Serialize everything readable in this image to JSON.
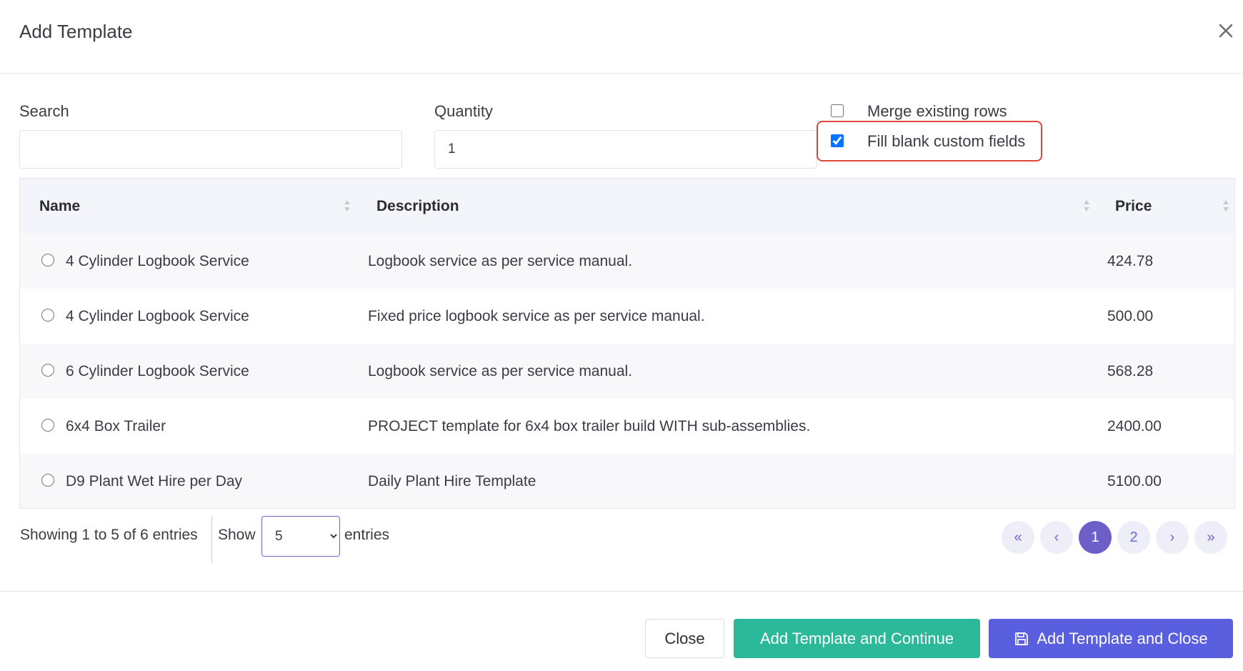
{
  "modal": {
    "title": "Add Template",
    "close_icon": "close-icon"
  },
  "form": {
    "search_label": "Search",
    "search_value": "",
    "quantity_label": "Quantity",
    "quantity_value": "1",
    "merge_label": "Merge existing rows",
    "merge_checked": false,
    "fill_label": "Fill blank custom fields",
    "fill_checked": true,
    "highlight_color": "#e0463a"
  },
  "table": {
    "headers": {
      "name": "Name",
      "description": "Description",
      "price": "Price"
    },
    "rows": [
      {
        "name": "4 Cylinder Logbook Service",
        "description": "Logbook service as per service manual.",
        "price": "424.78"
      },
      {
        "name": "4 Cylinder Logbook Service",
        "description": "Fixed price logbook service as per service manual.",
        "price": "500.00"
      },
      {
        "name": "6 Cylinder Logbook Service",
        "description": "Logbook service as per service manual.",
        "price": "568.28"
      },
      {
        "name": "6x4 Box Trailer",
        "description": "PROJECT template for 6x4 box trailer build WITH sub-assemblies.",
        "price": "2400.00"
      },
      {
        "name": "D9 Plant Wet Hire per Day",
        "description": "Daily Plant Hire Template",
        "price": "5100.00"
      }
    ]
  },
  "pagination": {
    "info": "Showing 1 to 5 of 6 entries",
    "show_label": "Show",
    "page_size": "5",
    "entries_label": "entries",
    "first": "«",
    "prev": "‹",
    "pages": [
      "1",
      "2"
    ],
    "active_page": "1",
    "next": "›",
    "last": "»"
  },
  "footer": {
    "close_label": "Close",
    "continue_label": "Add Template and Continue",
    "addclose_label": "Add Template and Close"
  },
  "colors": {
    "accent": "#6c5fc7",
    "continue_button": "#2bb99a",
    "addclose_button": "#5a5fe0"
  }
}
